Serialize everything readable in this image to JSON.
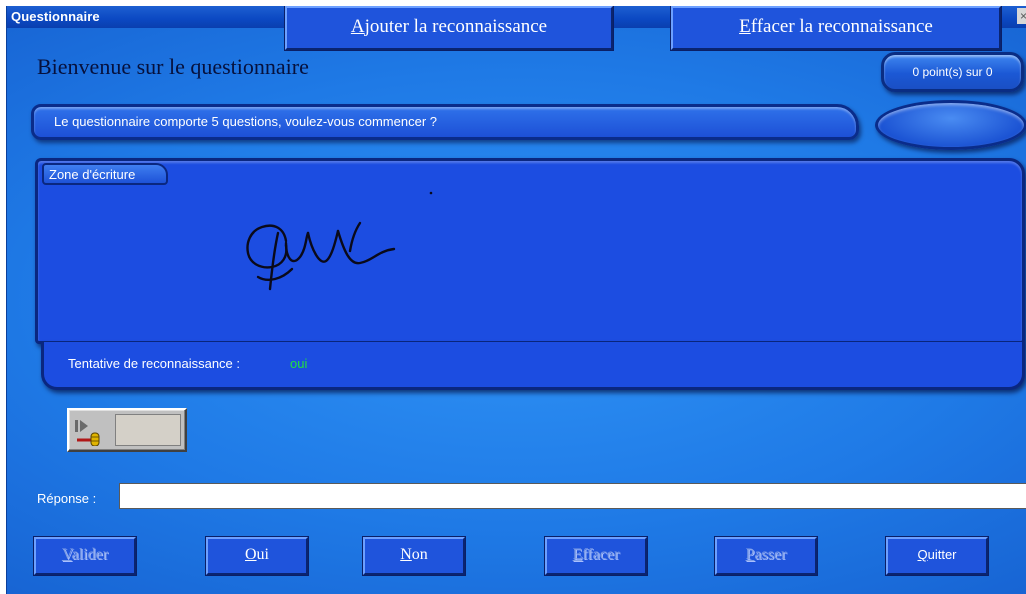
{
  "window": {
    "title": "Questionnaire",
    "close_glyph": "×"
  },
  "header": {
    "welcome": "Bienvenue sur le questionnaire",
    "score": "0 point(s) sur 0"
  },
  "message": "Le questionnaire comporte 5 questions, voulez-vous commencer ?",
  "writing_zone": {
    "label": "Zone d'écriture"
  },
  "recognition": {
    "label": "Tentative de reconnaissance :",
    "value": "oui",
    "value_color": "#20e040"
  },
  "recognition_buttons": {
    "add": {
      "first": "A",
      "rest": "jouter la reconnaissance"
    },
    "clear": {
      "first": "E",
      "rest": "ffacer la reconnaissance"
    }
  },
  "answer": {
    "label": "Réponse :",
    "value": ""
  },
  "bottom_buttons": [
    {
      "first": "V",
      "rest": "alider",
      "enabled": false
    },
    {
      "first": "O",
      "rest": "ui",
      "enabled": true
    },
    {
      "first": "N",
      "rest": "on",
      "enabled": true
    },
    {
      "first": "E",
      "rest": "ffacer",
      "enabled": false
    },
    {
      "first": "P",
      "rest": "asser",
      "enabled": false
    },
    {
      "first": "Q",
      "rest": "uitter",
      "enabled": true
    }
  ],
  "colors": {
    "background": "#1f7ae6",
    "panel": "#1c4de1",
    "button": "#1f54dc",
    "titlebar": "#0b48c2"
  },
  "icons": {
    "mic": "microphone-play-icon",
    "close": "close-icon"
  }
}
